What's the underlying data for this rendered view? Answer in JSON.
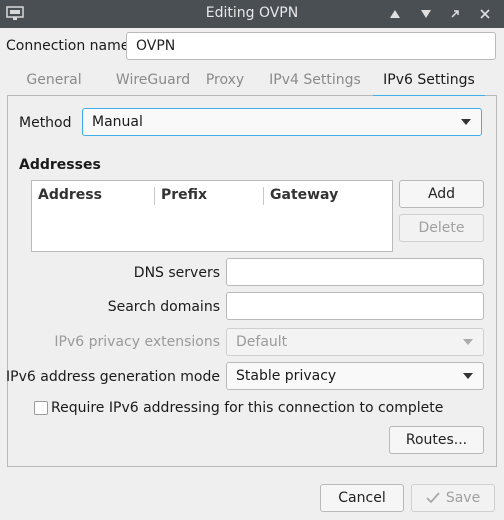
{
  "window": {
    "title": "Editing OVPN"
  },
  "connection": {
    "name_label": "Connection name",
    "name_value": "OVPN"
  },
  "tabs": [
    {
      "label": "General",
      "active": false
    },
    {
      "label": "WireGuard",
      "active": false
    },
    {
      "label": "Proxy",
      "active": false
    },
    {
      "label": "IPv4 Settings",
      "active": false
    },
    {
      "label": "IPv6 Settings",
      "active": true
    }
  ],
  "method": {
    "label": "Method",
    "value": "Manual"
  },
  "addresses": {
    "heading": "Addresses",
    "columns": [
      "Address",
      "Prefix",
      "Gateway"
    ],
    "add_label": "Add",
    "delete_label": "Delete"
  },
  "dns": {
    "label": "DNS servers",
    "value": ""
  },
  "search_domains": {
    "label": "Search domains",
    "value": ""
  },
  "privacy": {
    "label": "IPv6 privacy extensions",
    "value": "Default"
  },
  "addr_gen": {
    "label": "IPv6 address generation mode",
    "value": "Stable privacy"
  },
  "require": {
    "label": "Require IPv6 addressing for this connection to complete",
    "checked": false
  },
  "routes_label": "Routes...",
  "footer": {
    "cancel_label": "Cancel",
    "save_label": "Save"
  },
  "colors": {
    "accent": "#3daee9",
    "titlebar": "#4a4f54"
  }
}
